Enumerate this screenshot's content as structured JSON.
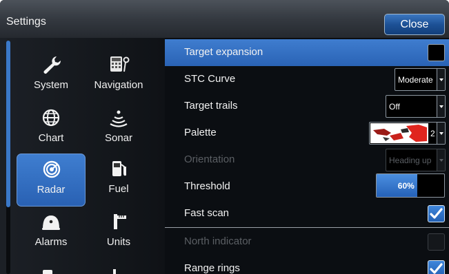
{
  "window": {
    "title": "Settings",
    "close_label": "Close"
  },
  "sidebar": {
    "items": [
      {
        "label": "System",
        "icon": "wrench-icon"
      },
      {
        "label": "Navigation",
        "icon": "navigation-icon"
      },
      {
        "label": "Chart",
        "icon": "globe-icon"
      },
      {
        "label": "Sonar",
        "icon": "sonar-icon"
      },
      {
        "label": "Radar",
        "icon": "radar-icon",
        "active": true
      },
      {
        "label": "Fuel",
        "icon": "fuel-pump-icon"
      },
      {
        "label": "Alarms",
        "icon": "alarm-bell-icon"
      },
      {
        "label": "Units",
        "icon": "ruler-icon"
      }
    ]
  },
  "settings": {
    "target_expansion": {
      "label": "Target expansion",
      "checked": false
    },
    "stc_curve": {
      "label": "STC Curve",
      "value": "Moderate"
    },
    "target_trails": {
      "label": "Target trails",
      "value": "Off"
    },
    "palette": {
      "label": "Palette",
      "value": "2"
    },
    "orientation": {
      "label": "Orientation",
      "value": "Heading up",
      "disabled": true
    },
    "threshold": {
      "label": "Threshold",
      "value": "60%",
      "level": 0.6
    },
    "fast_scan": {
      "label": "Fast scan",
      "checked": true
    },
    "north_indicator": {
      "label": "North indicator",
      "checked": false,
      "disabled": true
    },
    "range_rings": {
      "label": "Range rings",
      "checked": true
    }
  },
  "colors": {
    "accent": "#2f6cc0",
    "background": "#0b0e12",
    "palette_red": "#e0251e"
  }
}
